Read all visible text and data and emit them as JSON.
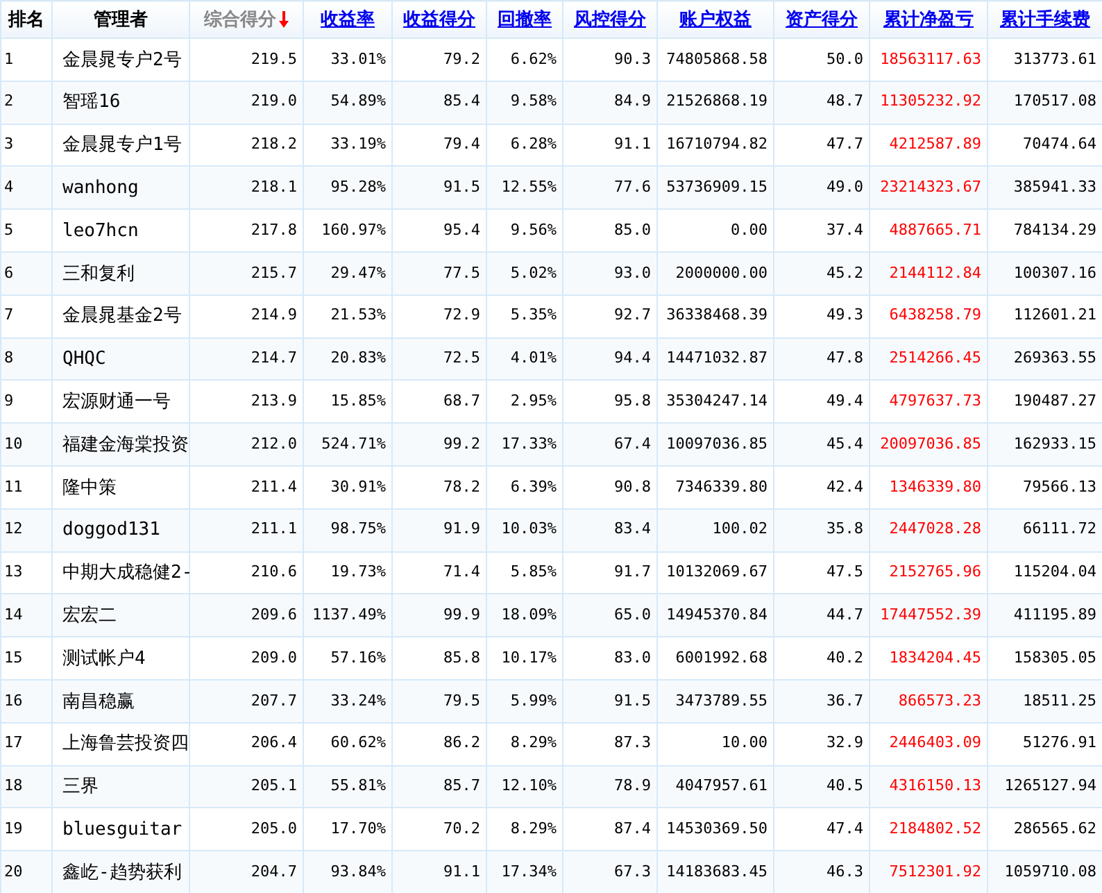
{
  "columns": [
    {
      "label": "排名",
      "kind": "plain",
      "highlighted": false
    },
    {
      "label": "管理者",
      "kind": "plain",
      "highlighted": false
    },
    {
      "label": "综合得分",
      "kind": "sorted",
      "highlighted": false
    },
    {
      "label": "收益率",
      "kind": "link",
      "highlighted": false
    },
    {
      "label": "收益得分",
      "kind": "link",
      "highlighted": false
    },
    {
      "label": "回撤率",
      "kind": "link",
      "highlighted": false
    },
    {
      "label": "风控得分",
      "kind": "link",
      "highlighted": false
    },
    {
      "label": "账户权益",
      "kind": "link",
      "highlighted": false
    },
    {
      "label": "资产得分",
      "kind": "link",
      "highlighted": false
    },
    {
      "label": "累计净盈亏",
      "kind": "link",
      "highlighted": true
    },
    {
      "label": "累计手续费",
      "kind": "link",
      "highlighted": false
    }
  ],
  "rows": [
    [
      "1",
      "金晨晁专户2号",
      "219.5",
      "33.01%",
      "79.2",
      "6.62%",
      "90.3",
      "74805868.58",
      "50.0",
      "18563117.63",
      "313773.61"
    ],
    [
      "2",
      "智瑶16",
      "219.0",
      "54.89%",
      "85.4",
      "9.58%",
      "84.9",
      "21526868.19",
      "48.7",
      "11305232.92",
      "170517.08"
    ],
    [
      "3",
      "金晨晁专户1号",
      "218.2",
      "33.19%",
      "79.4",
      "6.28%",
      "91.1",
      "16710794.82",
      "47.7",
      "4212587.89",
      "70474.64"
    ],
    [
      "4",
      "wanhong",
      "218.1",
      "95.28%",
      "91.5",
      "12.55%",
      "77.6",
      "53736909.15",
      "49.0",
      "23214323.67",
      "385941.33"
    ],
    [
      "5",
      "leo7hcn",
      "217.8",
      "160.97%",
      "95.4",
      "9.56%",
      "85.0",
      "0.00",
      "37.4",
      "4887665.71",
      "784134.29"
    ],
    [
      "6",
      "三和复利",
      "215.7",
      "29.47%",
      "77.5",
      "5.02%",
      "93.0",
      "2000000.00",
      "45.2",
      "2144112.84",
      "100307.16"
    ],
    [
      "7",
      "金晨晁基金2号",
      "214.9",
      "21.53%",
      "72.9",
      "5.35%",
      "92.7",
      "36338468.39",
      "49.3",
      "6438258.79",
      "112601.21"
    ],
    [
      "8",
      "QHQC",
      "214.7",
      "20.83%",
      "72.5",
      "4.01%",
      "94.4",
      "14471032.87",
      "47.8",
      "2514266.45",
      "269363.55"
    ],
    [
      "9",
      "宏源财通一号",
      "213.9",
      "15.85%",
      "68.7",
      "2.95%",
      "95.8",
      "35304247.14",
      "49.4",
      "4797637.73",
      "190487.27"
    ],
    [
      "10",
      "福建金海棠投资",
      "212.0",
      "524.71%",
      "99.2",
      "17.33%",
      "67.4",
      "10097036.85",
      "45.4",
      "20097036.85",
      "162933.15"
    ],
    [
      "11",
      "隆中策",
      "211.4",
      "30.91%",
      "78.2",
      "6.39%",
      "90.8",
      "7346339.80",
      "42.4",
      "1346339.80",
      "79566.13"
    ],
    [
      "12",
      "doggod131",
      "211.1",
      "98.75%",
      "91.9",
      "10.03%",
      "83.4",
      "100.02",
      "35.8",
      "2447028.28",
      "66111.72"
    ],
    [
      "13",
      "中期大成稳健2-",
      "210.6",
      "19.73%",
      "71.4",
      "5.85%",
      "91.7",
      "10132069.67",
      "47.5",
      "2152765.96",
      "115204.04"
    ],
    [
      "14",
      "宏宏二",
      "209.6",
      "1137.49%",
      "99.9",
      "18.09%",
      "65.0",
      "14945370.84",
      "44.7",
      "17447552.39",
      "411195.89"
    ],
    [
      "15",
      "测试帐户4",
      "209.0",
      "57.16%",
      "85.8",
      "10.17%",
      "83.0",
      "6001992.68",
      "40.2",
      "1834204.45",
      "158305.05"
    ],
    [
      "16",
      "南昌稳赢",
      "207.7",
      "33.24%",
      "79.5",
      "5.99%",
      "91.5",
      "3473789.55",
      "36.7",
      "866573.23",
      "18511.25"
    ],
    [
      "17",
      "上海鲁芸投资四",
      "206.4",
      "60.62%",
      "86.2",
      "8.29%",
      "87.3",
      "10.00",
      "32.9",
      "2446403.09",
      "51276.91"
    ],
    [
      "18",
      "三界",
      "205.1",
      "55.81%",
      "85.7",
      "12.10%",
      "78.9",
      "4047957.61",
      "40.5",
      "4316150.13",
      "1265127.94"
    ],
    [
      "19",
      "bluesguitar",
      "205.0",
      "17.70%",
      "70.2",
      "8.29%",
      "87.4",
      "14530369.50",
      "47.4",
      "2184802.52",
      "286565.62"
    ],
    [
      "20",
      "鑫屹-趋势获利",
      "204.7",
      "93.84%",
      "91.1",
      "17.34%",
      "67.3",
      "14183683.45",
      "46.3",
      "7512301.92",
      "1059710.08"
    ]
  ]
}
